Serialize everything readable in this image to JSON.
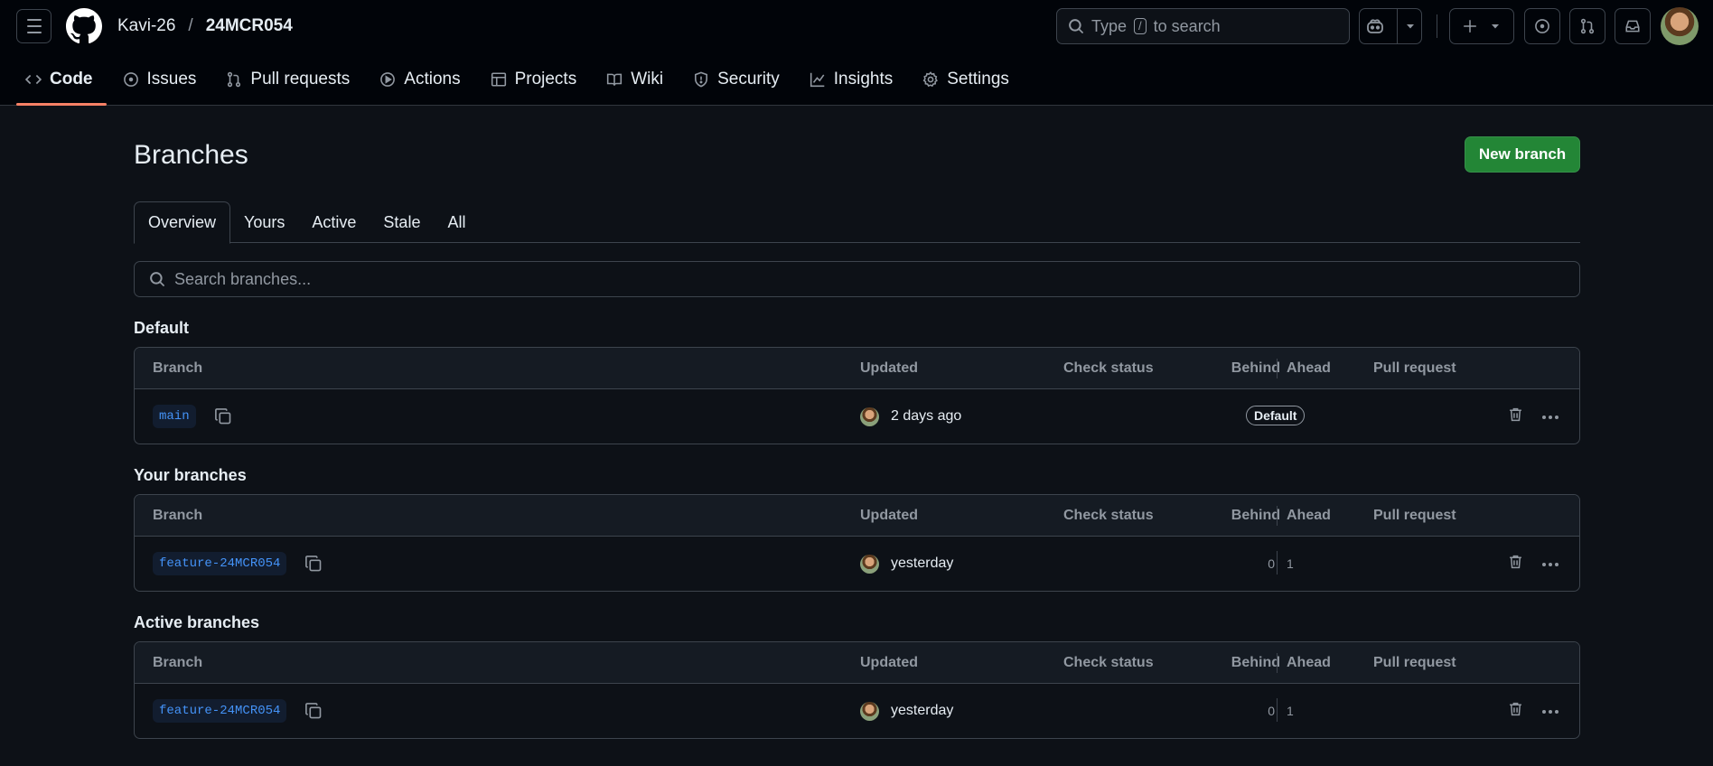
{
  "header": {
    "owner": "Kavi-26",
    "separator": "/",
    "repo": "24MCR054",
    "search": {
      "prefix": "Type",
      "key": "/",
      "suffix": "to search"
    }
  },
  "nav": {
    "items": [
      {
        "label": "Code",
        "icon": "code-icon"
      },
      {
        "label": "Issues",
        "icon": "issue-icon"
      },
      {
        "label": "Pull requests",
        "icon": "pull-request-icon"
      },
      {
        "label": "Actions",
        "icon": "play-icon"
      },
      {
        "label": "Projects",
        "icon": "table-icon"
      },
      {
        "label": "Wiki",
        "icon": "book-icon"
      },
      {
        "label": "Security",
        "icon": "shield-icon"
      },
      {
        "label": "Insights",
        "icon": "graph-icon"
      },
      {
        "label": "Settings",
        "icon": "gear-icon"
      }
    ]
  },
  "page": {
    "title": "Branches",
    "new_branch_label": "New branch",
    "tabs": [
      "Overview",
      "Yours",
      "Active",
      "Stale",
      "All"
    ],
    "search_placeholder": "Search branches..."
  },
  "table_headers": {
    "branch": "Branch",
    "updated": "Updated",
    "check_status": "Check status",
    "behind": "Behind",
    "ahead": "Ahead",
    "pull_request": "Pull request"
  },
  "sections": {
    "default": {
      "title": "Default",
      "row": {
        "branch": "main",
        "updated": "2 days ago",
        "badge": "Default"
      }
    },
    "yours": {
      "title": "Your branches",
      "row": {
        "branch": "feature-24MCR054",
        "updated": "yesterday",
        "behind": "0",
        "ahead": "1"
      }
    },
    "active": {
      "title": "Active branches",
      "row": {
        "branch": "feature-24MCR054",
        "updated": "yesterday",
        "behind": "0",
        "ahead": "1"
      }
    }
  },
  "colors": {
    "background": "#0d1117",
    "header_bg": "#010409",
    "accent_underline": "#f78166",
    "primary_button": "#238636",
    "link_blue": "#4493f8"
  }
}
